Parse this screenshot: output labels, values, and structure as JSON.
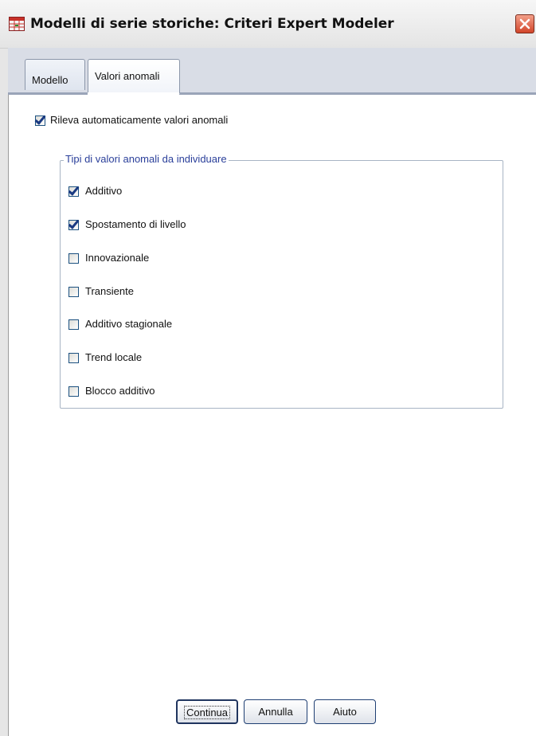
{
  "window": {
    "title": "Modelli di serie storiche: Criteri Expert Modeler",
    "icon": "table-icon",
    "close_icon": "close-icon"
  },
  "tabs": [
    {
      "label": "Modello",
      "selected": false
    },
    {
      "label": "Valori anomali",
      "selected": true
    }
  ],
  "auto_detect": {
    "label": "Rileva automaticamente valori anomali",
    "checked": true
  },
  "outlier_types": {
    "legend": "Tipi di valori anomali da individuare",
    "items": [
      {
        "label": "Additivo",
        "checked": true
      },
      {
        "label": "Spostamento di livello",
        "checked": true
      },
      {
        "label": "Innovazionale",
        "checked": false
      },
      {
        "label": "Transiente",
        "checked": false
      },
      {
        "label": "Additivo stagionale",
        "checked": false
      },
      {
        "label": "Trend locale",
        "checked": false
      },
      {
        "label": "Blocco additivo",
        "checked": false
      }
    ]
  },
  "buttons": {
    "continue": "Continua",
    "cancel": "Annulla",
    "help": "Aiuto"
  },
  "colors": {
    "accent_blue": "#2a3f9a",
    "check_color": "#1a3a82",
    "close_red": "#d2452a"
  }
}
